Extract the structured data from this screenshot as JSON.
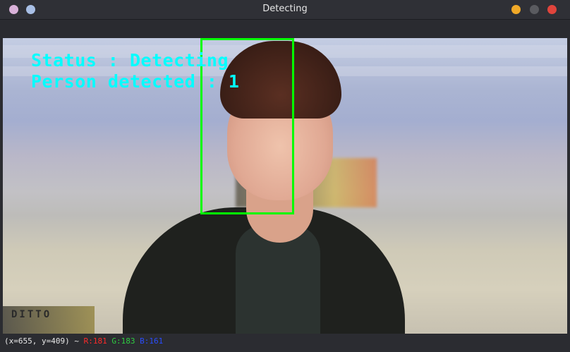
{
  "window": {
    "title": "Detecting",
    "left_controls": [
      {
        "name": "left-dot-1-icon",
        "color": "#d9b1d9"
      },
      {
        "name": "left-dot-2-icon",
        "color": "#a8bfe6"
      }
    ],
    "right_controls": [
      {
        "name": "minimize-button",
        "color": "#f0a928"
      },
      {
        "name": "maximize-button",
        "color": "#5a5b60"
      },
      {
        "name": "close-button",
        "color": "#e0443c"
      }
    ]
  },
  "overlay": {
    "status_line": "Status : Detecting",
    "count_line": "Person detected : 1",
    "text_color": "#00ffff",
    "box_color": "#00ff00"
  },
  "image": {
    "sign_text": "DITTO"
  },
  "statusbar": {
    "coords": "(x=655, y=409) ~ ",
    "r": "R:181",
    "g": "G:183",
    "b": "B:161",
    "r_color": "#ff2a2a",
    "g_color": "#2ecc40",
    "b_color": "#2a4dff"
  }
}
